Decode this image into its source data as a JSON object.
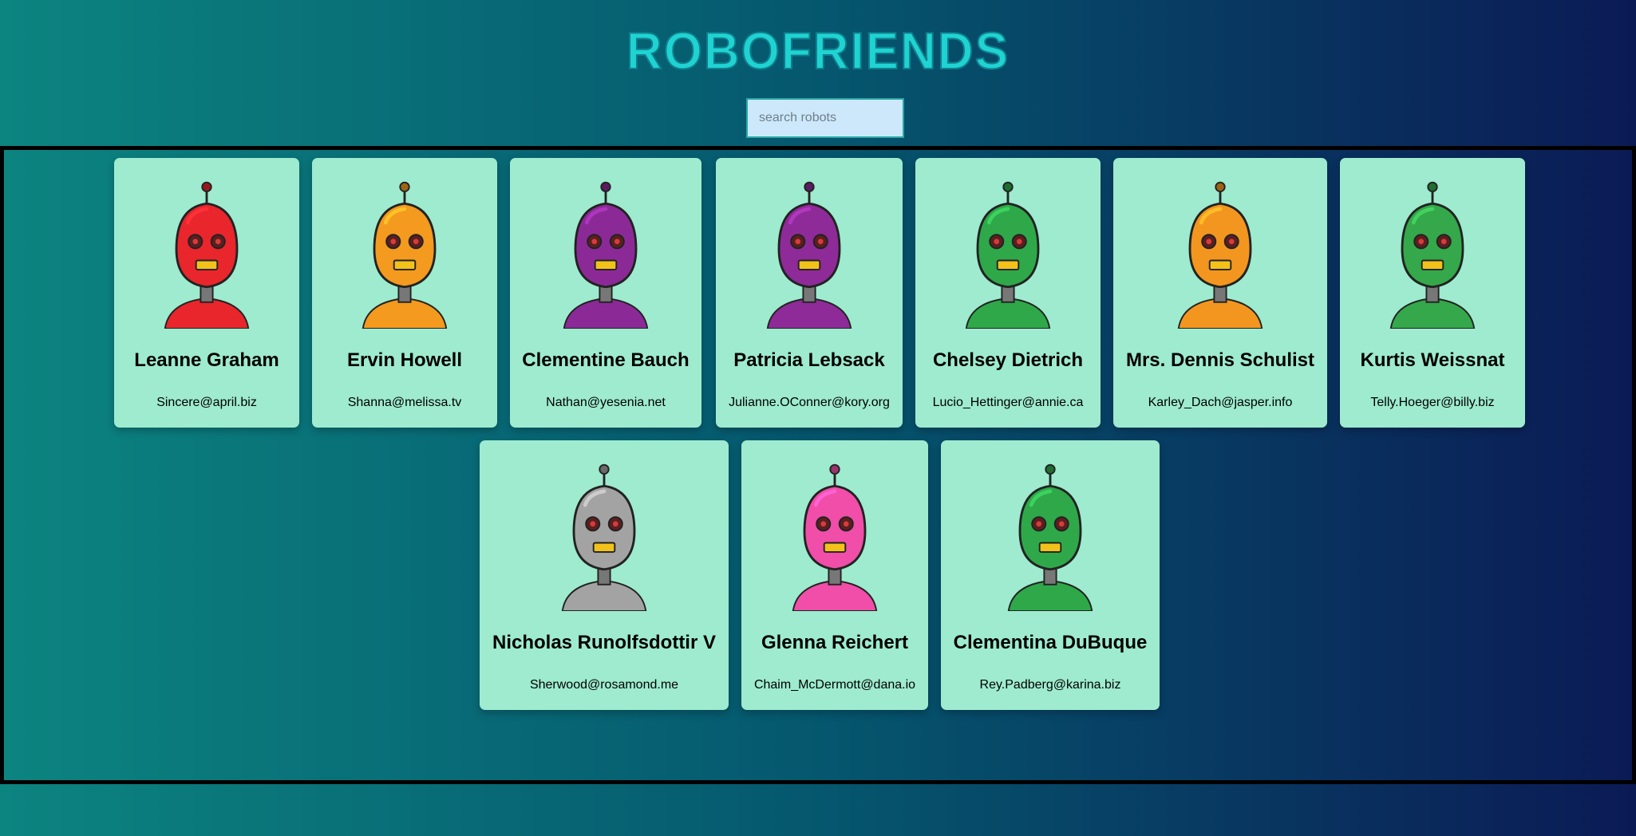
{
  "app_title": "ROBOFRIENDS",
  "search": {
    "placeholder": "search robots",
    "value": ""
  },
  "robots": [
    {
      "name": "Leanne Graham",
      "email": "Sincere@april.biz",
      "color": "#e8262c"
    },
    {
      "name": "Ervin Howell",
      "email": "Shanna@melissa.tv",
      "color": "#f39a1f"
    },
    {
      "name": "Clementine Bauch",
      "email": "Nathan@yesenia.net",
      "color": "#8b2a97"
    },
    {
      "name": "Patricia Lebsack",
      "email": "Julianne.OConner@kory.org",
      "color": "#8e2b98"
    },
    {
      "name": "Chelsey Dietrich",
      "email": "Lucio_Hettinger@annie.ca",
      "color": "#2fa84a"
    },
    {
      "name": "Mrs. Dennis Schulist",
      "email": "Karley_Dach@jasper.info",
      "color": "#f3961f"
    },
    {
      "name": "Kurtis Weissnat",
      "email": "Telly.Hoeger@billy.biz",
      "color": "#34a84a"
    },
    {
      "name": "Nicholas Runolfsdottir V",
      "email": "Sherwood@rosamond.me",
      "color": "#a3a3a3"
    },
    {
      "name": "Glenna Reichert",
      "email": "Chaim_McDermott@dana.io",
      "color": "#f04ea8"
    },
    {
      "name": "Clementina DuBuque",
      "email": "Rey.Padberg@karina.biz",
      "color": "#2fa84a"
    }
  ]
}
